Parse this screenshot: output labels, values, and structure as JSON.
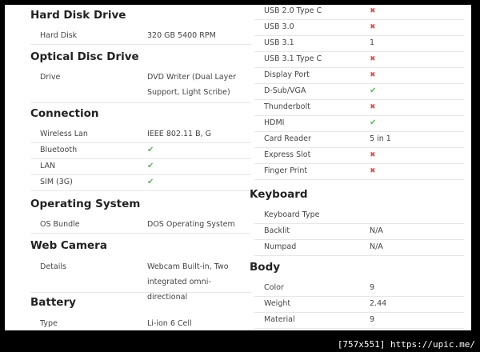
{
  "left": {
    "hard_disk": {
      "title": "Hard Disk Drive",
      "rows": [
        {
          "label": "Hard Disk",
          "value": "320 GB 5400 RPM"
        }
      ]
    },
    "optical": {
      "title": "Optical Disc Drive",
      "rows": [
        {
          "label": "Drive",
          "value": "DVD Writer (Dual Layer Support, Light Scribe)"
        }
      ]
    },
    "connection": {
      "title": "Connection",
      "rows": [
        {
          "label": "Wireless Lan",
          "value": "IEEE 802.11 B, G"
        },
        {
          "label": "Bluetooth",
          "icon": "check-icon"
        },
        {
          "label": "LAN",
          "icon": "check-icon"
        },
        {
          "label": "SIM (3G)",
          "icon": "check-icon"
        }
      ]
    },
    "os": {
      "title": "Operating System",
      "rows": [
        {
          "label": "OS Bundle",
          "value": "DOS Operating System"
        }
      ]
    },
    "webcam": {
      "title": "Web Camera",
      "rows": [
        {
          "label": "Details",
          "value": "Webcam Built-in, Two integrated omni-directional"
        }
      ]
    },
    "battery": {
      "title": "Battery",
      "rows": [
        {
          "label": "Type",
          "value": "Li-ion 6 Cell"
        }
      ]
    }
  },
  "right": {
    "ports": {
      "rows": [
        {
          "label": "USB 2.0 Type C",
          "icon": "cross-icon"
        },
        {
          "label": "USB 3.0",
          "icon": "cross-icon"
        },
        {
          "label": "USB 3.1",
          "value": "1"
        },
        {
          "label": "USB 3.1 Type C",
          "icon": "cross-icon"
        },
        {
          "label": "Display Port",
          "icon": "cross-icon"
        },
        {
          "label": "D-Sub/VGA",
          "icon": "check-icon"
        },
        {
          "label": "Thunderbolt",
          "icon": "cross-icon"
        },
        {
          "label": "HDMI",
          "icon": "check-icon"
        },
        {
          "label": "Card Reader",
          "value": "5 in 1"
        },
        {
          "label": "Express Slot",
          "icon": "cross-icon"
        },
        {
          "label": "Finger Print",
          "icon": "cross-icon"
        }
      ]
    },
    "keyboard": {
      "title": "Keyboard",
      "rows": [
        {
          "label": "Keyboard Type",
          "value": ""
        },
        {
          "label": "Backlit",
          "value": "N/A"
        },
        {
          "label": "Numpad",
          "value": "N/A"
        }
      ]
    },
    "body": {
      "title": "Body",
      "rows": [
        {
          "label": "Color",
          "value": "9"
        },
        {
          "label": "Weight",
          "value": "2.44"
        },
        {
          "label": "Material",
          "value": "9"
        }
      ]
    }
  },
  "icons": {
    "check": "✔",
    "cross": "✖"
  },
  "colors": {
    "check": "#5cb85c",
    "cross": "#d9534f"
  },
  "watermark": "[757x551] https://upic.me/"
}
